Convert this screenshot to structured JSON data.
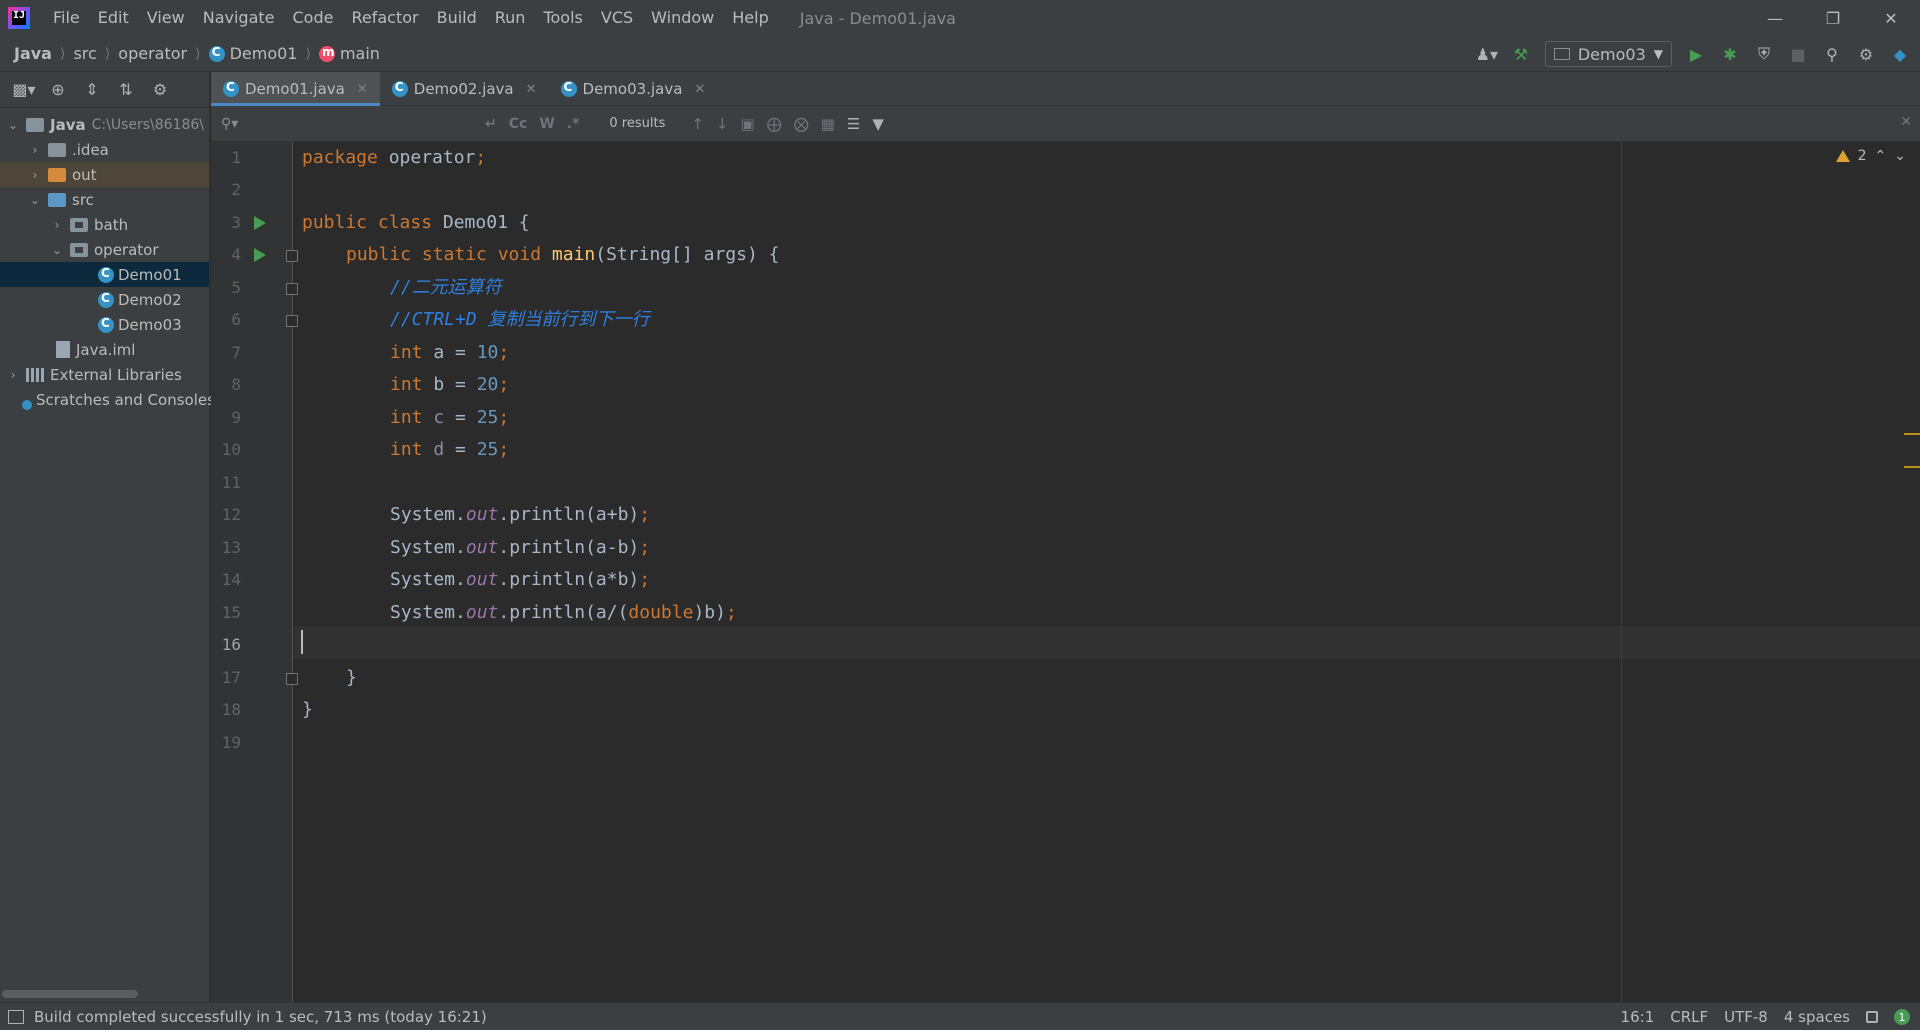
{
  "window": {
    "title": "Java - Demo01.java",
    "menu": [
      "File",
      "Edit",
      "View",
      "Navigate",
      "Code",
      "Refactor",
      "Build",
      "Run",
      "Tools",
      "VCS",
      "Window",
      "Help"
    ]
  },
  "breadcrumb": [
    "Java",
    "src",
    "operator",
    "Demo01",
    "main"
  ],
  "run_config": "Demo03",
  "project_tree": {
    "root_label": "Java",
    "root_path": "C:\\Users\\86186\\",
    "items": [
      {
        "label": ".idea"
      },
      {
        "label": "out"
      },
      {
        "label": "src"
      },
      {
        "label": "bath"
      },
      {
        "label": "operator"
      },
      {
        "label": "Demo01"
      },
      {
        "label": "Demo02"
      },
      {
        "label": "Demo03"
      },
      {
        "label": "Java.iml"
      },
      {
        "label": "External Libraries"
      },
      {
        "label": "Scratches and Consoles"
      }
    ]
  },
  "tabs": [
    {
      "label": "Demo01.java",
      "active": true
    },
    {
      "label": "Demo02.java",
      "active": false
    },
    {
      "label": "Demo03.java",
      "active": false
    }
  ],
  "find": {
    "placeholder": "",
    "opt_case": "Cc",
    "opt_words": "W",
    "opt_regex": ".*",
    "results": "0 results"
  },
  "editor": {
    "line_numbers": [
      "1",
      "2",
      "3",
      "4",
      "5",
      "6",
      "7",
      "8",
      "9",
      "10",
      "11",
      "12",
      "13",
      "14",
      "15",
      "16",
      "17",
      "18",
      "19"
    ],
    "current_line": "16",
    "warnings_count": "2",
    "code": {
      "l1_kw": "package",
      "l1_rest": " operator",
      "semi": ";",
      "l3_kw": "public class",
      "l3_rest": " Demo01 {",
      "l4_kw": "public static void",
      "l4_method": "main",
      "l4_rest": "(String[] args) {",
      "l5_comment": "//二元运算符",
      "l6_comment": "//CTRL+D 复制当前行到下一行",
      "int_kw": "int",
      "l7_var": " a = ",
      "l7_val": "10",
      "l8_var": " b = ",
      "l8_val": "20",
      "l9_var": "c",
      "l9_val": "25",
      "l10_var": "d",
      "l10_val": "25",
      "system": "System.",
      "out": "out",
      "l12_rest": ".println(a+b)",
      "l13_rest": ".println(a-b)",
      "l14_rest": ".println(a*b)",
      "l15_rest1": ".println(a/(",
      "l15_kw": "double",
      "l15_rest2": ")b)",
      "close_brace": "}"
    }
  },
  "status": {
    "message": "Build completed successfully in 1 sec, 713 ms (today 16:21)",
    "position": "16:1",
    "line_sep": "CRLF",
    "encoding": "UTF-8",
    "indent": "4 spaces",
    "notifications": "1"
  }
}
